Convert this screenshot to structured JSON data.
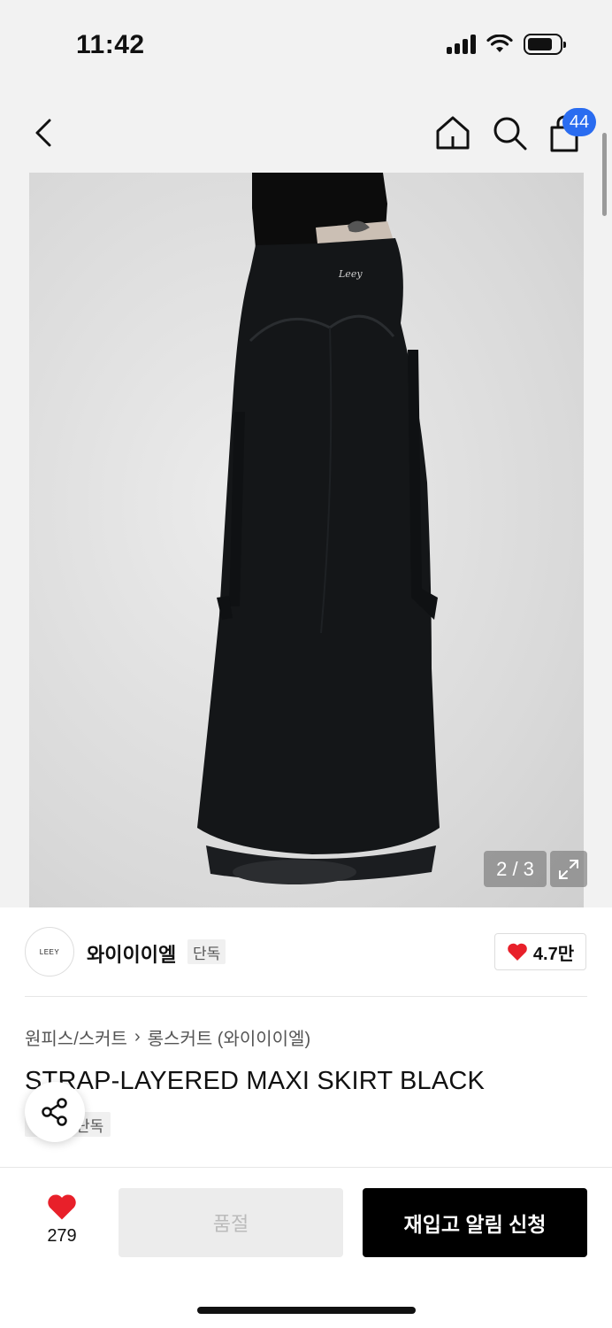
{
  "status_bar": {
    "time": "11:42"
  },
  "header": {
    "cart_badge": "44"
  },
  "gallery": {
    "counter": "2 / 3",
    "image_subject": "black strap-layered maxi skirt on model",
    "logo_script": "Leey"
  },
  "brand": {
    "logo_text": "LEEY",
    "name": "와이이이엘",
    "exclusive_label": "단독",
    "likes": "4.7만"
  },
  "breadcrumb": {
    "category": "원피스/스커트",
    "separator": "›",
    "subcategory": "롱스커트 (와이이이엘)"
  },
  "product": {
    "title": "STRAP-LAYERED MAXI SKIRT BLACK",
    "exclusive_label": "단독"
  },
  "bottom_bar": {
    "wish_count": "279",
    "soldout_label": "품절",
    "restock_label": "재입고 알림 신청"
  },
  "colors": {
    "accent_blue": "#2a6cf0",
    "heart_red": "#e8202a",
    "primary_black": "#000000"
  }
}
